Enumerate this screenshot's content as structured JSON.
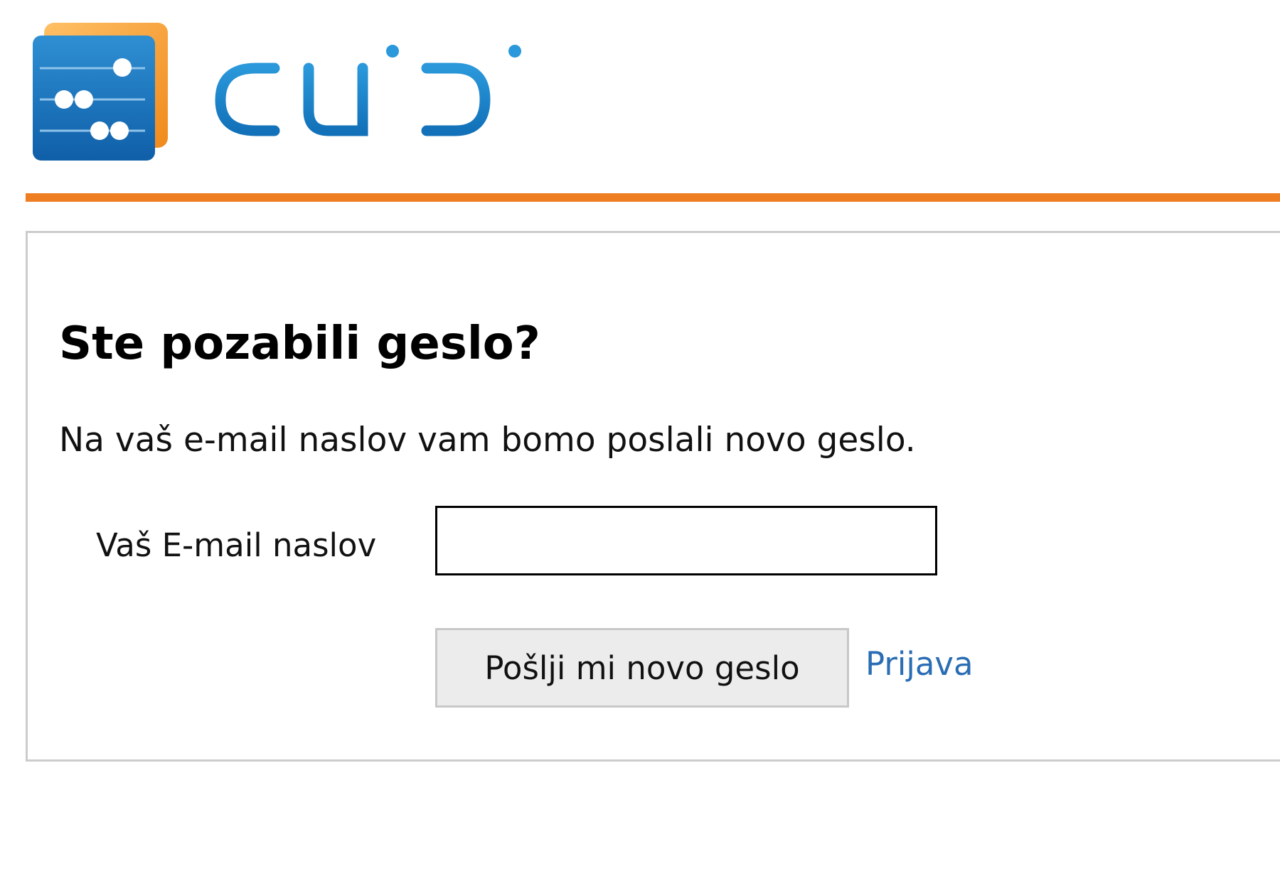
{
  "brand": {
    "name": "quibi",
    "icon": "quibi-abacus-logo-icon",
    "colors": {
      "logo_blue": "#1b7fc4",
      "logo_orange": "#f39a2b",
      "accent_rule": "#ef7d22",
      "link": "#2a6db4"
    }
  },
  "form": {
    "title": "Ste pozabili geslo?",
    "intro": "Na vaš e-mail naslov vam bomo poslali novo geslo.",
    "email_label": "Vaš E-mail naslov",
    "email_value": "",
    "email_placeholder": "",
    "submit_label": "Pošlji mi novo geslo",
    "login_link": "Prijava"
  }
}
